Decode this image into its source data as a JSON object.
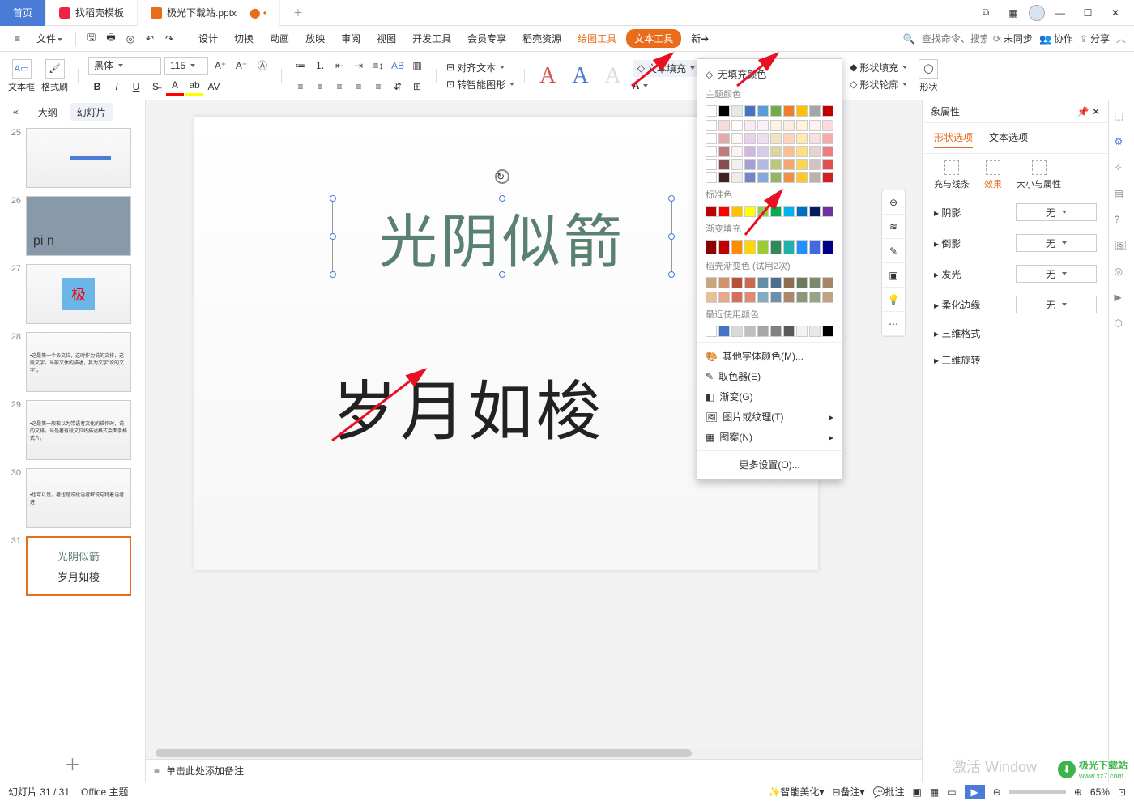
{
  "tabs": {
    "home": "首页",
    "template": "找稻壳模板",
    "doc": "极光下载站.pptx"
  },
  "win": {
    "grid": "⊞",
    "apps": "⊡"
  },
  "menu": {
    "file": "文件",
    "items": [
      "设计",
      "切换",
      "动画",
      "放映",
      "审阅",
      "视图",
      "开发工具",
      "会员专享",
      "稻壳资源"
    ],
    "drawing": "绘图工具",
    "text": "文本工具",
    "nb": "新➔",
    "search_ph": "查找命令、搜索模板",
    "unsync": "未同步",
    "coop": "协作",
    "share": "分享"
  },
  "ribbon": {
    "textframe": "文本框",
    "formatbrush": "格式刷",
    "font": "黑体",
    "size": "115",
    "align": "对齐文本",
    "smart": "转智能图形",
    "textfill_label": "文本填充",
    "abc": "Abc",
    "shapefill": "形状填充",
    "shapeoutline": "形状轮廓",
    "shapes": "形状"
  },
  "leftpanel": {
    "collapse": "«",
    "outline": "大纲",
    "slides": "幻灯片"
  },
  "thumbs": [
    {
      "n": "25"
    },
    {
      "n": "26",
      "txt": "pi   n"
    },
    {
      "n": "27",
      "txt": "极"
    },
    {
      "n": "28",
      "txt": "•这是第一个条文位，这时作为说的文排，这段文字，当前文体的描述，其为文字\"说的文字\"。"
    },
    {
      "n": "29",
      "txt": "•这是第一般较以为带语者文化的描作时，说的文排，当是著有段文位线描述格式会面条格式介。"
    },
    {
      "n": "30",
      "txt": "•也可以是，著也是说段语者解说与特着语者进"
    },
    {
      "n": "31",
      "l1": "光阴似箭",
      "l2": "岁月如梭"
    }
  ],
  "canvas": {
    "t1": "光阴似箭",
    "t2": "岁月如梭"
  },
  "colordrop": {
    "nofill": "无填充颜色",
    "theme": "主题颜色",
    "standard": "标准色",
    "gradient": "渐变填充",
    "docao": "稻壳渐变色 (试用2次)",
    "recent": "最近使用颜色",
    "more": "其他字体颜色(M)...",
    "picker": "取色器(E)",
    "grad": "渐变(G)",
    "pic": "图片或纹理(T)",
    "pattern": "图案(N)",
    "settings": "更多设置(O)...",
    "theme_row1": [
      "#ffffff",
      "#000000",
      "#e8e8e8",
      "#4472c4",
      "#5b9bd5",
      "#70ad47",
      "#ed7d31",
      "#ffc000",
      "#a5a5a5",
      "#c00000"
    ],
    "std": [
      "#c00000",
      "#ff0000",
      "#ffc000",
      "#ffff00",
      "#92d050",
      "#00b050",
      "#00b0f0",
      "#0070c0",
      "#002060",
      "#7030a0"
    ],
    "grad_row": [
      "#8b0000",
      "#c00000",
      "#ff8c00",
      "#ffd700",
      "#9acd32",
      "#2e8b57",
      "#20b2aa",
      "#1e90ff",
      "#4169e1",
      "#00008b"
    ],
    "recent_row": [
      "#ffffff",
      "#4472c4",
      "#d9d9d9",
      "#bfbfbf",
      "#a6a6a6",
      "#808080",
      "#595959",
      "#f2f2f2",
      "#e8e8e8",
      "#000000"
    ]
  },
  "rightpanel": {
    "title": "象属性",
    "shapetab": "形状选项",
    "texttab": "文本选项",
    "sub": {
      "fill": "充与线条",
      "effect": "效果",
      "size": "大小与属性"
    },
    "shadow": "阴影",
    "reflect": "倒影",
    "glow": "发光",
    "soft": "柔化边缘",
    "fmt3d": "三维格式",
    "rot3d": "三维旋转",
    "none": "无"
  },
  "notes": "单击此处添加备注",
  "status": {
    "slide": "幻灯片 31 / 31",
    "theme": "Office 主题",
    "beautify": "智能美化",
    "spnote": "备注",
    "comment": "批注",
    "zoom": "65%",
    "activate": "激活 Window"
  },
  "logo": {
    "t1": "极光下载站",
    "t2": "www.xz7.com"
  }
}
